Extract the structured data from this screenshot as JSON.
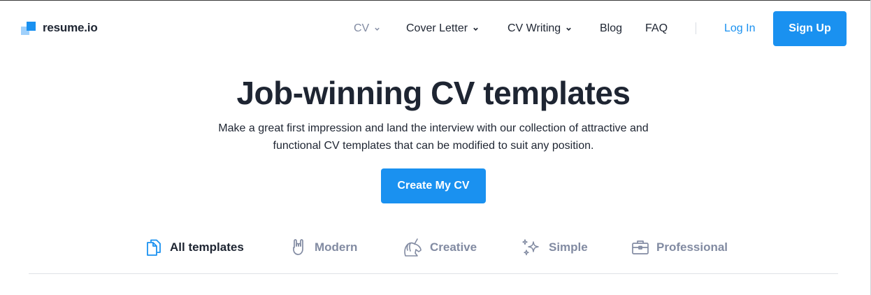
{
  "header": {
    "logo_text": "resume.io",
    "nav": [
      {
        "label": "CV",
        "has_dropdown": true,
        "muted": true
      },
      {
        "label": "Cover Letter",
        "has_dropdown": true
      },
      {
        "label": "CV Writing",
        "has_dropdown": true
      },
      {
        "label": "Blog",
        "has_dropdown": false
      },
      {
        "label": "FAQ",
        "has_dropdown": false
      }
    ],
    "login_label": "Log In",
    "signup_label": "Sign Up"
  },
  "hero": {
    "title": "Job-winning CV templates",
    "subtitle_line1": "Make a great first impression and land the interview with our collection of attractive and",
    "subtitle_line2": "functional CV templates that can be modified to suit any position.",
    "cta_label": "Create My CV"
  },
  "tabs": [
    {
      "label": "All templates",
      "icon": "documents-icon",
      "active": true
    },
    {
      "label": "Modern",
      "icon": "rock-hand-icon",
      "active": false
    },
    {
      "label": "Creative",
      "icon": "unicorn-icon",
      "active": false
    },
    {
      "label": "Simple",
      "icon": "sparkles-icon",
      "active": false
    },
    {
      "label": "Professional",
      "icon": "briefcase-icon",
      "active": false
    }
  ],
  "colors": {
    "accent": "#1a91f0",
    "text": "#1e2532",
    "muted": "#828ba2"
  }
}
